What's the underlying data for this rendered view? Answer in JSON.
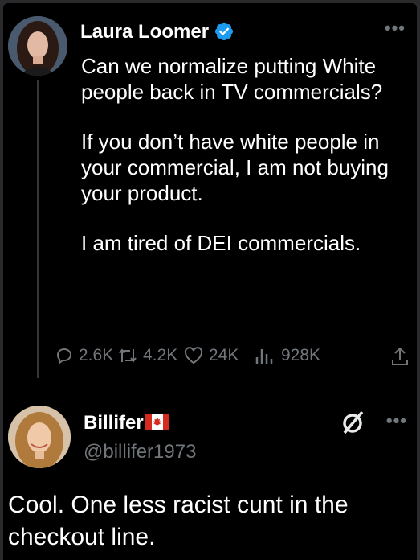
{
  "post1": {
    "author": "Laura Loomer",
    "paragraphs": [
      "Can we normalize putting White people back in TV commercials?",
      "If you don’t have white people in your commercial, I am not buying your product.",
      "I am tired of DEI commercials."
    ],
    "stats": {
      "replies": "2.6K",
      "reposts": "4.2K",
      "likes": "24K",
      "views": "928K"
    },
    "more_label": "•••"
  },
  "post2": {
    "author": "Billifer",
    "handle": "@billifer1973",
    "text": "Cool. One less racist cunt in the checkout line.",
    "more_label": "•••"
  },
  "colors": {
    "background": "#000000",
    "text": "#ffffff",
    "muted": "#71767b",
    "verified": "#1d9bf0",
    "thread_line": "#333639"
  }
}
